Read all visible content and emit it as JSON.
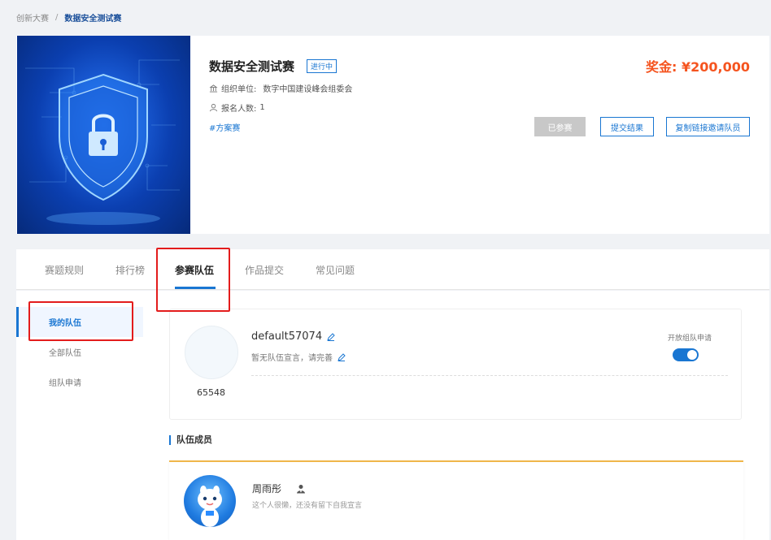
{
  "breadcrumb": {
    "parent": "创新大赛",
    "separator": "/",
    "current": "数据安全测试赛"
  },
  "competition": {
    "title": "数据安全测试赛",
    "status": "进行中",
    "organizer_label": "组织单位:",
    "organizer": "数字中国建设峰会组委会",
    "signup_label": "报名人数:",
    "signup_count": "1",
    "tag": "#方案赛",
    "prize_label": "奖金:",
    "prize_value": "¥200,000"
  },
  "actions": {
    "joined": "已参赛",
    "submit": "提交结果",
    "invite": "复制链接邀请队员"
  },
  "tabs": [
    {
      "label": "赛题规则"
    },
    {
      "label": "排行榜"
    },
    {
      "label": "参赛队伍"
    },
    {
      "label": "作品提交"
    },
    {
      "label": "常见问题"
    }
  ],
  "side_menu": [
    {
      "label": "我的队伍"
    },
    {
      "label": "全部队伍"
    },
    {
      "label": "组队申请"
    }
  ],
  "team": {
    "name": "default57074",
    "slogan": "暂无队伍宣言，请完善",
    "id": "65548",
    "open_apply_label": "开放组队申请",
    "open_apply_enabled": true
  },
  "members_section_title": "队伍成员",
  "members": [
    {
      "name": "周雨彤",
      "desc": "这个人很懒，还没有留下自我宣言"
    }
  ],
  "colors": {
    "accent": "#1976d2",
    "prize": "#f5541f",
    "highlight": "#e31c1c",
    "member_border": "#f0b64a"
  }
}
